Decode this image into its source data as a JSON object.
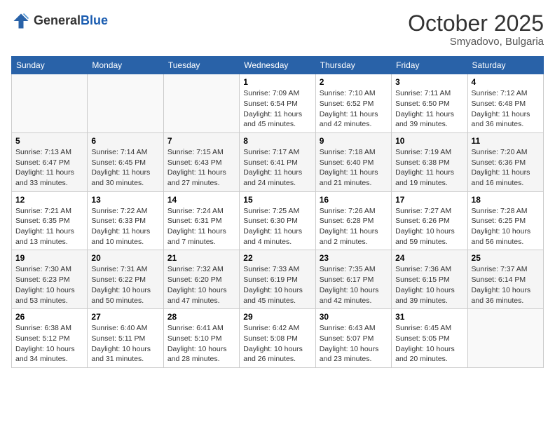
{
  "header": {
    "logo_general": "General",
    "logo_blue": "Blue",
    "month": "October 2025",
    "location": "Smyadovo, Bulgaria"
  },
  "weekdays": [
    "Sunday",
    "Monday",
    "Tuesday",
    "Wednesday",
    "Thursday",
    "Friday",
    "Saturday"
  ],
  "weeks": [
    [
      {
        "day": "",
        "info": ""
      },
      {
        "day": "",
        "info": ""
      },
      {
        "day": "",
        "info": ""
      },
      {
        "day": "1",
        "info": "Sunrise: 7:09 AM\nSunset: 6:54 PM\nDaylight: 11 hours and 45 minutes."
      },
      {
        "day": "2",
        "info": "Sunrise: 7:10 AM\nSunset: 6:52 PM\nDaylight: 11 hours and 42 minutes."
      },
      {
        "day": "3",
        "info": "Sunrise: 7:11 AM\nSunset: 6:50 PM\nDaylight: 11 hours and 39 minutes."
      },
      {
        "day": "4",
        "info": "Sunrise: 7:12 AM\nSunset: 6:48 PM\nDaylight: 11 hours and 36 minutes."
      }
    ],
    [
      {
        "day": "5",
        "info": "Sunrise: 7:13 AM\nSunset: 6:47 PM\nDaylight: 11 hours and 33 minutes."
      },
      {
        "day": "6",
        "info": "Sunrise: 7:14 AM\nSunset: 6:45 PM\nDaylight: 11 hours and 30 minutes."
      },
      {
        "day": "7",
        "info": "Sunrise: 7:15 AM\nSunset: 6:43 PM\nDaylight: 11 hours and 27 minutes."
      },
      {
        "day": "8",
        "info": "Sunrise: 7:17 AM\nSunset: 6:41 PM\nDaylight: 11 hours and 24 minutes."
      },
      {
        "day": "9",
        "info": "Sunrise: 7:18 AM\nSunset: 6:40 PM\nDaylight: 11 hours and 21 minutes."
      },
      {
        "day": "10",
        "info": "Sunrise: 7:19 AM\nSunset: 6:38 PM\nDaylight: 11 hours and 19 minutes."
      },
      {
        "day": "11",
        "info": "Sunrise: 7:20 AM\nSunset: 6:36 PM\nDaylight: 11 hours and 16 minutes."
      }
    ],
    [
      {
        "day": "12",
        "info": "Sunrise: 7:21 AM\nSunset: 6:35 PM\nDaylight: 11 hours and 13 minutes."
      },
      {
        "day": "13",
        "info": "Sunrise: 7:22 AM\nSunset: 6:33 PM\nDaylight: 11 hours and 10 minutes."
      },
      {
        "day": "14",
        "info": "Sunrise: 7:24 AM\nSunset: 6:31 PM\nDaylight: 11 hours and 7 minutes."
      },
      {
        "day": "15",
        "info": "Sunrise: 7:25 AM\nSunset: 6:30 PM\nDaylight: 11 hours and 4 minutes."
      },
      {
        "day": "16",
        "info": "Sunrise: 7:26 AM\nSunset: 6:28 PM\nDaylight: 11 hours and 2 minutes."
      },
      {
        "day": "17",
        "info": "Sunrise: 7:27 AM\nSunset: 6:26 PM\nDaylight: 10 hours and 59 minutes."
      },
      {
        "day": "18",
        "info": "Sunrise: 7:28 AM\nSunset: 6:25 PM\nDaylight: 10 hours and 56 minutes."
      }
    ],
    [
      {
        "day": "19",
        "info": "Sunrise: 7:30 AM\nSunset: 6:23 PM\nDaylight: 10 hours and 53 minutes."
      },
      {
        "day": "20",
        "info": "Sunrise: 7:31 AM\nSunset: 6:22 PM\nDaylight: 10 hours and 50 minutes."
      },
      {
        "day": "21",
        "info": "Sunrise: 7:32 AM\nSunset: 6:20 PM\nDaylight: 10 hours and 47 minutes."
      },
      {
        "day": "22",
        "info": "Sunrise: 7:33 AM\nSunset: 6:19 PM\nDaylight: 10 hours and 45 minutes."
      },
      {
        "day": "23",
        "info": "Sunrise: 7:35 AM\nSunset: 6:17 PM\nDaylight: 10 hours and 42 minutes."
      },
      {
        "day": "24",
        "info": "Sunrise: 7:36 AM\nSunset: 6:15 PM\nDaylight: 10 hours and 39 minutes."
      },
      {
        "day": "25",
        "info": "Sunrise: 7:37 AM\nSunset: 6:14 PM\nDaylight: 10 hours and 36 minutes."
      }
    ],
    [
      {
        "day": "26",
        "info": "Sunrise: 6:38 AM\nSunset: 5:12 PM\nDaylight: 10 hours and 34 minutes."
      },
      {
        "day": "27",
        "info": "Sunrise: 6:40 AM\nSunset: 5:11 PM\nDaylight: 10 hours and 31 minutes."
      },
      {
        "day": "28",
        "info": "Sunrise: 6:41 AM\nSunset: 5:10 PM\nDaylight: 10 hours and 28 minutes."
      },
      {
        "day": "29",
        "info": "Sunrise: 6:42 AM\nSunset: 5:08 PM\nDaylight: 10 hours and 26 minutes."
      },
      {
        "day": "30",
        "info": "Sunrise: 6:43 AM\nSunset: 5:07 PM\nDaylight: 10 hours and 23 minutes."
      },
      {
        "day": "31",
        "info": "Sunrise: 6:45 AM\nSunset: 5:05 PM\nDaylight: 10 hours and 20 minutes."
      },
      {
        "day": "",
        "info": ""
      }
    ]
  ]
}
